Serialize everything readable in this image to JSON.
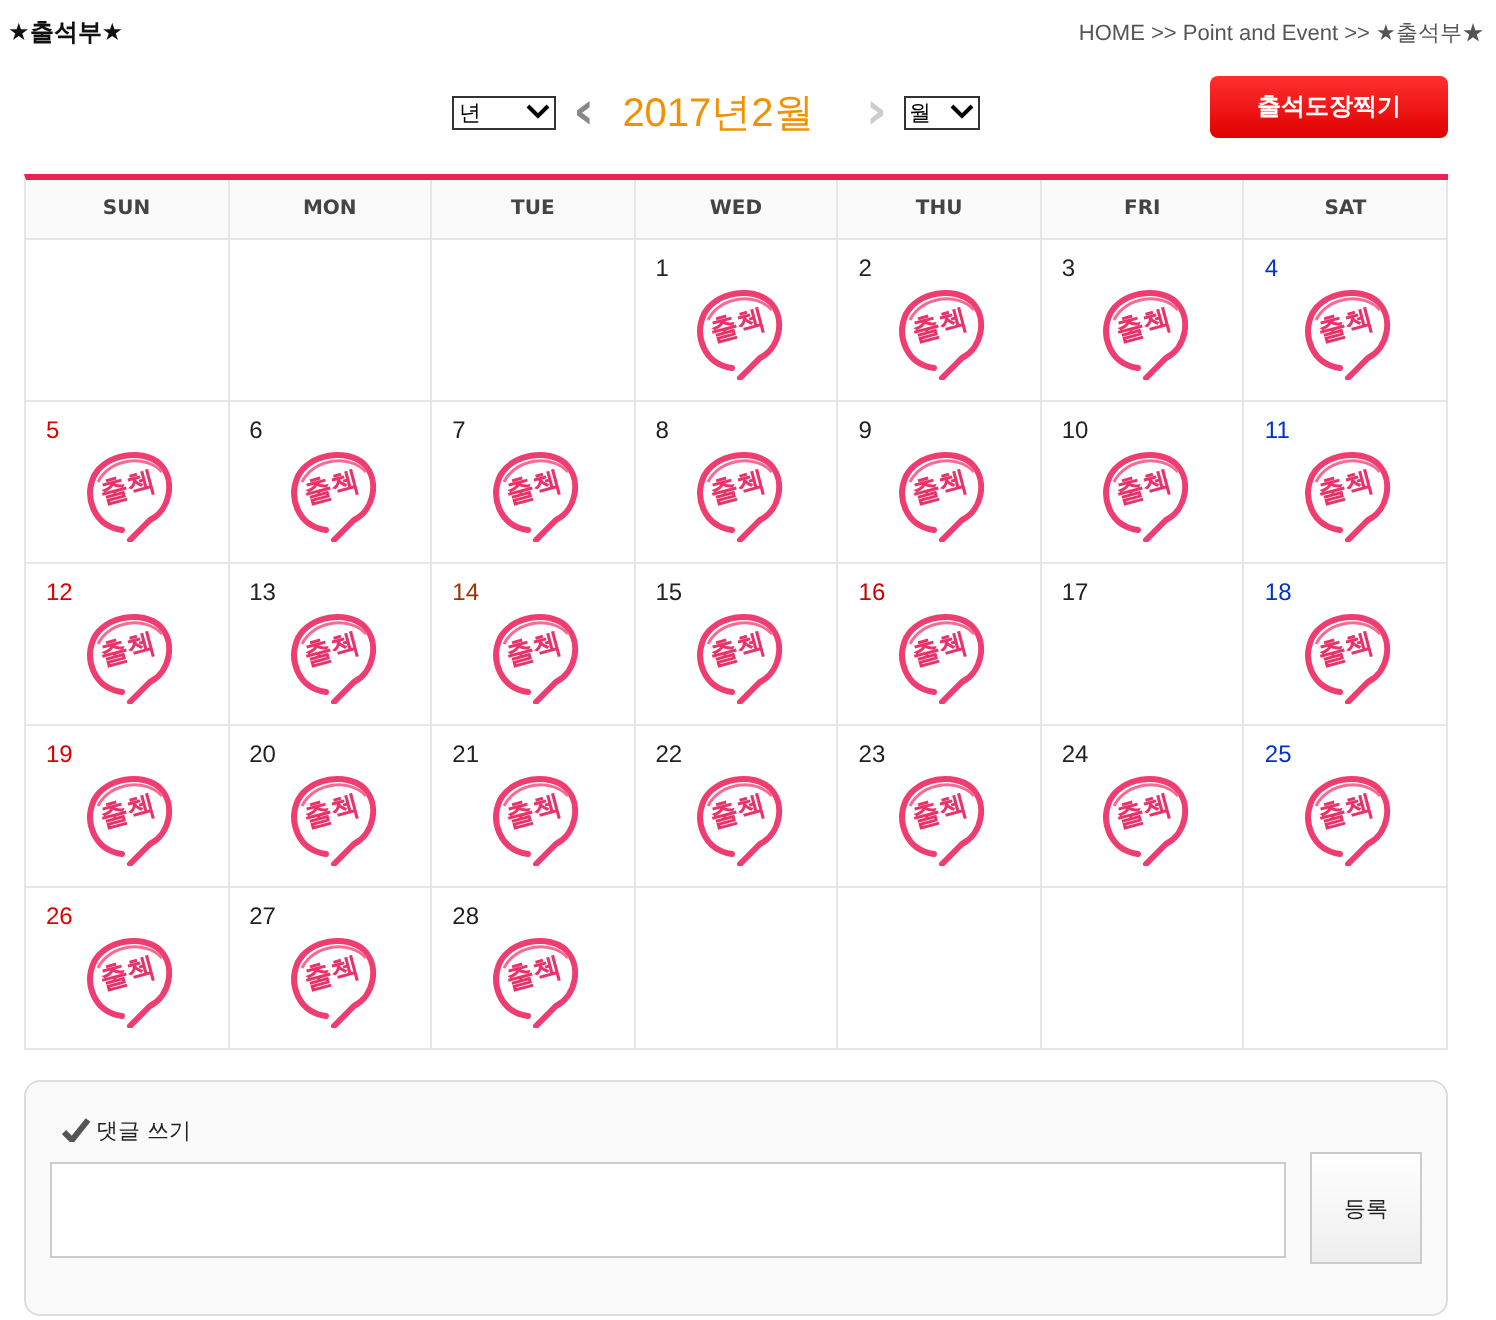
{
  "page_title": "★출석부★",
  "breadcrumb": "HOME >> Point and Event >> ★출석부★",
  "nav": {
    "year_select": "년",
    "prev": "‹",
    "month_title": "2017년2월",
    "next": "›",
    "month_select": "월",
    "stamp_button": "출석도장찍기"
  },
  "weekdays": [
    "SUN",
    "MON",
    "TUE",
    "WED",
    "THU",
    "FRI",
    "SAT"
  ],
  "weeks": [
    {
      "days": [
        {
          "kind": "blank"
        },
        {
          "kind": "blank"
        },
        {
          "kind": "blank"
        },
        {
          "kind": "day",
          "label": "1",
          "color": "#222222",
          "stamp": "출첵"
        },
        {
          "kind": "day",
          "label": "2",
          "color": "#222222",
          "stamp": "출첵"
        },
        {
          "kind": "day",
          "label": "3",
          "color": "#222222",
          "stamp": "출첵"
        },
        {
          "kind": "day",
          "label": "4",
          "color": "#0033cc",
          "stamp": "출첵"
        }
      ]
    },
    {
      "days": [
        {
          "kind": "day",
          "label": "5",
          "color": "#dd0000",
          "stamp": "출첵"
        },
        {
          "kind": "day",
          "label": "6",
          "color": "#222222",
          "stamp": "출첵"
        },
        {
          "kind": "day",
          "label": "7",
          "color": "#222222",
          "stamp": "출첵"
        },
        {
          "kind": "day",
          "label": "8",
          "color": "#222222",
          "stamp": "출첵"
        },
        {
          "kind": "day",
          "label": "9",
          "color": "#222222",
          "stamp": "출첵"
        },
        {
          "kind": "day",
          "label": "10",
          "color": "#222222",
          "stamp": "출첵"
        },
        {
          "kind": "day",
          "label": "11",
          "color": "#0033cc",
          "stamp": "출첵"
        }
      ]
    },
    {
      "days": [
        {
          "kind": "day",
          "label": "12",
          "color": "#dd0000",
          "stamp": "출첵"
        },
        {
          "kind": "day",
          "label": "13",
          "color": "#222222",
          "stamp": "출첵"
        },
        {
          "kind": "day",
          "label": "14",
          "color": "#993300",
          "stamp": "출첵"
        },
        {
          "kind": "day",
          "label": "15",
          "color": "#222222",
          "stamp": "출첵"
        },
        {
          "kind": "day",
          "label": "16",
          "color": "#cc0000",
          "stamp": "출첵"
        },
        {
          "kind": "day",
          "label": "17",
          "color": "#222222"
        },
        {
          "kind": "day",
          "label": "18",
          "color": "#0033cc",
          "stamp": "출첵"
        }
      ]
    },
    {
      "days": [
        {
          "kind": "day",
          "label": "19",
          "color": "#dd0000",
          "stamp": "출첵"
        },
        {
          "kind": "day",
          "label": "20",
          "color": "#222222",
          "stamp": "출첵"
        },
        {
          "kind": "day",
          "label": "21",
          "color": "#222222",
          "stamp": "출첵"
        },
        {
          "kind": "day",
          "label": "22",
          "color": "#222222",
          "stamp": "출첵"
        },
        {
          "kind": "day",
          "label": "23",
          "color": "#222222",
          "stamp": "출첵"
        },
        {
          "kind": "day",
          "label": "24",
          "color": "#222222",
          "stamp": "출첵"
        },
        {
          "kind": "day",
          "label": "25",
          "color": "#0033cc",
          "stamp": "출첵"
        }
      ]
    },
    {
      "days": [
        {
          "kind": "day",
          "label": "26",
          "color": "#dd0000",
          "stamp": "출첵"
        },
        {
          "kind": "day",
          "label": "27",
          "color": "#222222",
          "stamp": "출첵"
        },
        {
          "kind": "day",
          "label": "28",
          "color": "#222222",
          "stamp": "출첵"
        },
        {
          "kind": "blank"
        },
        {
          "kind": "blank"
        },
        {
          "kind": "blank"
        },
        {
          "kind": "blank"
        }
      ]
    }
  ],
  "comment": {
    "heading": "댓글 쓰기",
    "submit": "등록"
  }
}
